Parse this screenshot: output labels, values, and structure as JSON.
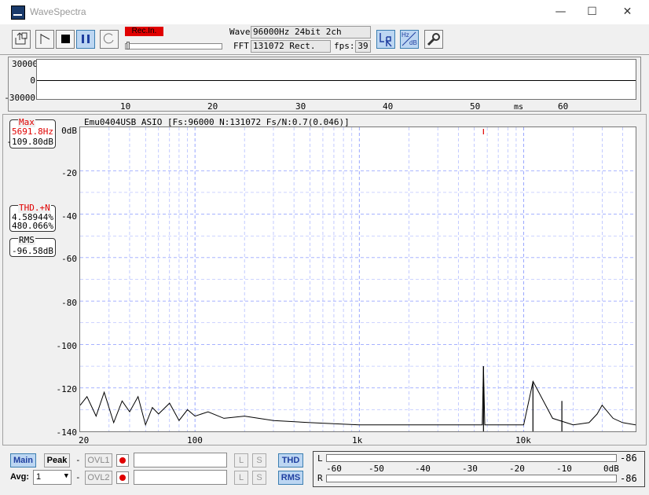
{
  "window": {
    "title": "WaveSpectra",
    "minimize": "—",
    "maximize": "☐",
    "close": "✕"
  },
  "toolbar": {
    "rec_label": "Rec.In.",
    "wave_label": "Wave:",
    "wave_value": "96000Hz 24bit 2ch",
    "fft_label": "FFT:",
    "fft_value": "131072 Rect.",
    "fps_label": "fps:",
    "fps_value": "39",
    "lr_label": "L R",
    "hz_label": "Hz",
    "db_label": "dB"
  },
  "wave": {
    "y_ticks": [
      "30000",
      "0",
      "-30000"
    ],
    "x_ticks": [
      "10",
      "20",
      "30",
      "40",
      "50",
      "60"
    ],
    "x_unit": "ms"
  },
  "spectrum": {
    "header": "Emu0404USB ASIO  [Fs:96000 N:131072 Fs/N:0.7(0.046)]",
    "y_ticks": [
      "0dB",
      "-20",
      "-40",
      "-60",
      "-80",
      "-100",
      "-120",
      "-140"
    ],
    "x_ticks": [
      "20",
      "100",
      "1k",
      "10k"
    ]
  },
  "readouts": {
    "max_label": "Max",
    "max_freq": "5691.8Hz",
    "max_level": "-109.80dB",
    "thd_label": "THD.+N",
    "thd_pct": "4.58944%",
    "thd_val": "480.066%",
    "rms_label": "RMS",
    "rms_value": "-96.58dB"
  },
  "bottom": {
    "main_label": "Main",
    "peak_label": "Peak",
    "dash1": "-",
    "dash2": "-",
    "ovl1_label": "OVL1",
    "ovl2_label": "OVL2",
    "avg_label": "Avg:",
    "avg_value": "1",
    "l_label": "L",
    "s_label": "S",
    "thd_btn": "THD",
    "rms_btn": "RMS"
  },
  "meter": {
    "ch_l": "L",
    "ch_r": "R",
    "scale": [
      "-60",
      "-50",
      "-40",
      "-30",
      "-20",
      "-10",
      "0dB"
    ],
    "l_value": "-86",
    "r_value": "-86"
  },
  "colors": {
    "accent_red": "#e00000",
    "grid": "#9aa8ff",
    "active_blue": "#bcd6f2"
  },
  "chart_data": {
    "type": "line",
    "title": "",
    "xlabel": "",
    "ylabel": "",
    "x_scale": "log",
    "xlim": [
      20,
      48000
    ],
    "ylim": [
      -140,
      0
    ],
    "series": [
      {
        "x": [
          20,
          22,
          25,
          28,
          32,
          36,
          40,
          45,
          50,
          55,
          60,
          70,
          80,
          90,
          100,
          120,
          150,
          200,
          300,
          500,
          1000,
          2000,
          3000,
          4000,
          5000,
          5600,
          5692,
          5800,
          7000,
          10000,
          11400,
          15000,
          20000,
          25000,
          28000,
          30000,
          35000,
          40000,
          48000
        ],
        "y": [
          -128,
          -124,
          -133,
          -122,
          -136,
          -126,
          -131,
          -124,
          -137,
          -129,
          -132,
          -127,
          -135,
          -130,
          -133,
          -131,
          -134,
          -133,
          -135,
          -136,
          -137,
          -137,
          -137,
          -137,
          -137,
          -137,
          -110,
          -137,
          -137,
          -137,
          -117,
          -134,
          -137,
          -136,
          -132,
          -128,
          -134,
          -136,
          -137
        ]
      }
    ],
    "peaks": [
      {
        "freq": 5692,
        "level": -110
      },
      {
        "freq": 11384,
        "level": -117
      },
      {
        "freq": 17076,
        "level": -126
      }
    ]
  }
}
